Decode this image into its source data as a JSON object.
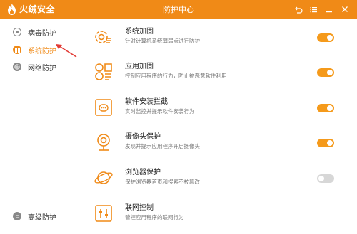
{
  "app": {
    "brand": "火绒安全",
    "title": "防护中心"
  },
  "colors": {
    "accent": "#f08a17",
    "toggle_on": "#f59a1b",
    "toggle_off": "#d7d7d7"
  },
  "sidebar": {
    "items": [
      {
        "label": "病毒防护",
        "icon": "virus-shield-icon",
        "active": false
      },
      {
        "label": "系统防护",
        "icon": "windows-icon",
        "active": true
      },
      {
        "label": "网络防护",
        "icon": "globe-icon",
        "active": false
      }
    ],
    "bottom_item": {
      "label": "高级防护",
      "icon": "advanced-shield-icon"
    }
  },
  "features": [
    {
      "name": "系统加固",
      "desc": "针对计算机系统薄弱点进行防护",
      "icon": "gear-shield-icon",
      "enabled": true
    },
    {
      "name": "应用加固",
      "desc": "控制应用程序的行为，防止被恶意软件利用",
      "icon": "apps-icon",
      "enabled": true
    },
    {
      "name": "软件安装拦截",
      "desc": "实时监控并提示软件安装行为",
      "icon": "install-block-icon",
      "enabled": true
    },
    {
      "name": "摄像头保护",
      "desc": "发现并提示应用程序开启摄像头",
      "icon": "webcam-icon",
      "enabled": true
    },
    {
      "name": "浏览器保护",
      "desc": "保护浏览器首页和搜索不被篡改",
      "icon": "browser-planet-icon",
      "enabled": false
    },
    {
      "name": "联网控制",
      "desc": "管控应用程序的联网行为",
      "icon": "network-control-icon",
      "enabled": null
    }
  ]
}
